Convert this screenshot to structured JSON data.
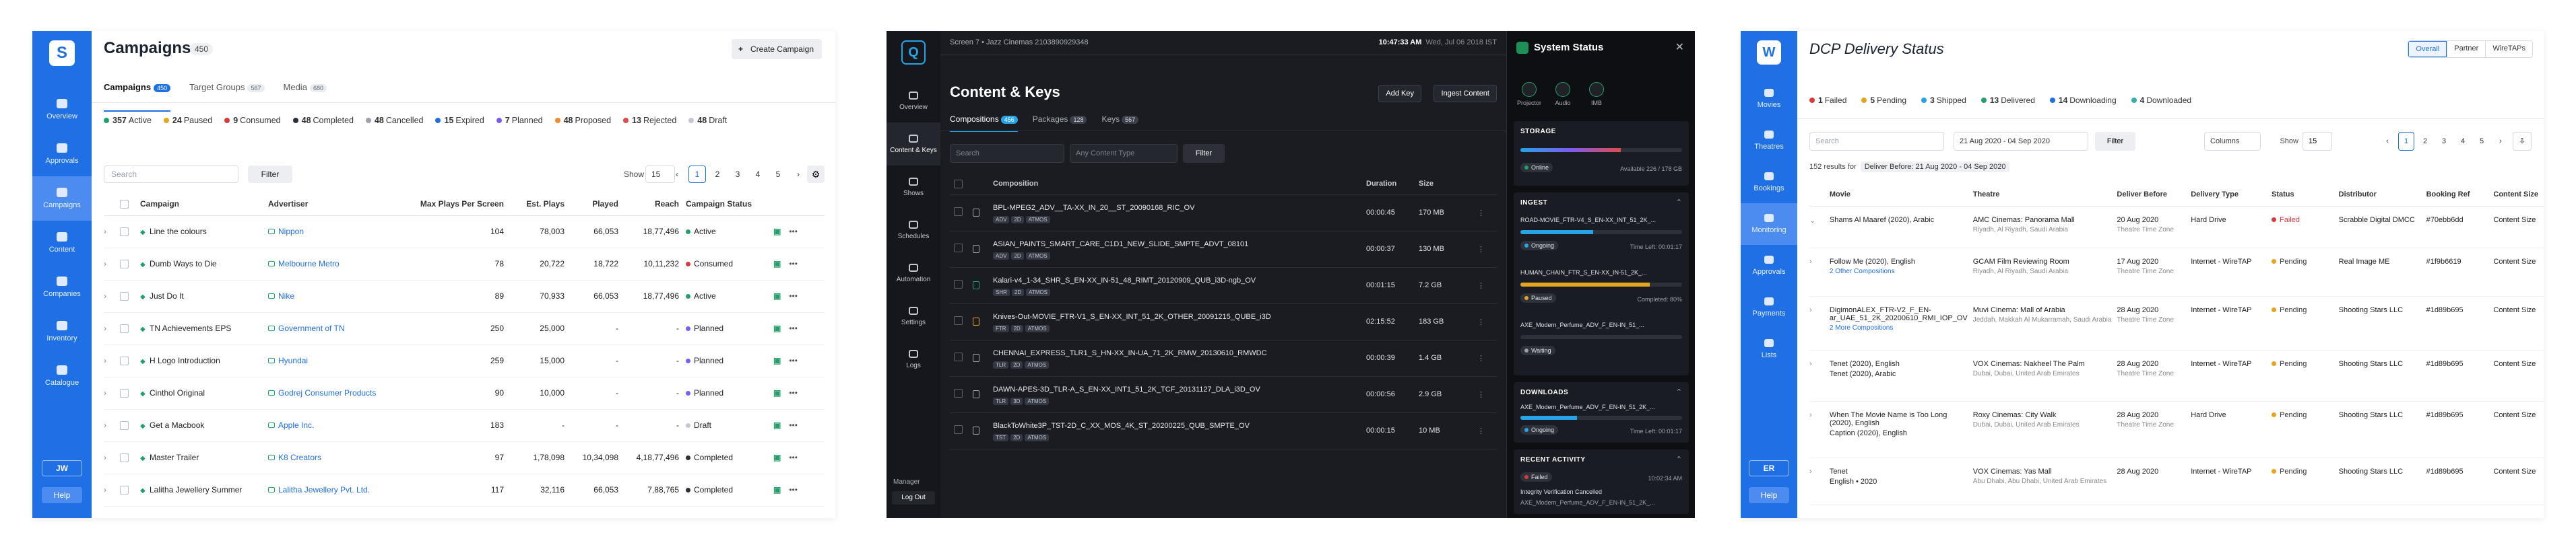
{
  "campaigns": {
    "sidebar": {
      "logo": "S",
      "items": [
        {
          "label": "Overview",
          "active": false
        },
        {
          "label": "Approvals",
          "active": false
        },
        {
          "label": "Campaigns",
          "active": true
        },
        {
          "label": "Content",
          "active": false
        },
        {
          "label": "Companies",
          "active": false
        },
        {
          "label": "Inventory",
          "active": false
        },
        {
          "label": "Catalogue",
          "active": false
        }
      ],
      "user": "JW",
      "help": "Help"
    },
    "title": "Campaigns",
    "count": "450",
    "create_button": "Create Campaign",
    "tabs": [
      {
        "label": "Campaigns",
        "count": "450"
      },
      {
        "label": "Target Groups",
        "count": "567"
      },
      {
        "label": "Media",
        "count": "680"
      }
    ],
    "stats": [
      {
        "value": "357",
        "label": "Active",
        "color": "#22a06b"
      },
      {
        "value": "24",
        "label": "Paused",
        "color": "#e5a521"
      },
      {
        "value": "9",
        "label": "Consumed",
        "color": "#d63b3b"
      },
      {
        "value": "48",
        "label": "Completed",
        "color": "#2b2f37"
      },
      {
        "value": "48",
        "label": "Cancelled",
        "color": "#9aa1ab"
      },
      {
        "value": "15",
        "label": "Expired",
        "color": "#1f6fe5"
      },
      {
        "value": "7",
        "label": "Planned",
        "color": "#7b5cf0"
      },
      {
        "value": "48",
        "label": "Proposed",
        "color": "#f08c2e"
      },
      {
        "value": "13",
        "label": "Rejected",
        "color": "#e14b4b"
      },
      {
        "value": "48",
        "label": "Draft",
        "color": "#c3c8d0"
      }
    ],
    "search_placeholder": "Search",
    "filter": "Filter",
    "show_label": "Show",
    "show_value": "15",
    "pages": [
      "1",
      "2",
      "3",
      "4",
      "5"
    ],
    "columns": [
      "Campaign",
      "Advertiser",
      "Max Plays Per Screen",
      "Est. Plays",
      "Played",
      "Reach",
      "Campaign Status"
    ],
    "rows": [
      {
        "campaign": "Line the colours",
        "advertiser": "Nippon",
        "max": "104",
        "est": "78,003",
        "played": "66,053",
        "reach": "18,77,496",
        "status": "Active",
        "color": "#22a06b"
      },
      {
        "campaign": "Dumb Ways to Die",
        "advertiser": "Melbourne Metro",
        "max": "78",
        "est": "20,722",
        "played": "18,722",
        "reach": "10,11,232",
        "status": "Consumed",
        "color": "#d63b3b"
      },
      {
        "campaign": "Just Do It",
        "advertiser": "Nike",
        "max": "89",
        "est": "70,933",
        "played": "66,053",
        "reach": "18,77,496",
        "status": "Active",
        "color": "#22a06b"
      },
      {
        "campaign": "TN Achievements EPS",
        "advertiser": "Government of TN",
        "max": "250",
        "est": "25,000",
        "played": "-",
        "reach": "-",
        "status": "Planned",
        "color": "#7b5cf0"
      },
      {
        "campaign": "H Logo Introduction",
        "advertiser": "Hyundai",
        "max": "259",
        "est": "15,000",
        "played": "-",
        "reach": "-",
        "status": "Planned",
        "color": "#7b5cf0"
      },
      {
        "campaign": "Cinthol Original",
        "advertiser": "Godrej Consumer Products",
        "max": "90",
        "est": "10,000",
        "played": "-",
        "reach": "-",
        "status": "Planned",
        "color": "#7b5cf0"
      },
      {
        "campaign": "Get a Macbook",
        "advertiser": "Apple Inc.",
        "max": "183",
        "est": "-",
        "played": "-",
        "reach": "-",
        "status": "Draft",
        "color": "#c3c8d0"
      },
      {
        "campaign": "Master Trailer",
        "advertiser": "K8 Creators",
        "max": "97",
        "est": "1,78,098",
        "played": "10,34,098",
        "reach": "4,18,77,496",
        "status": "Completed",
        "color": "#2b2f37"
      },
      {
        "campaign": "Lalitha Jewellery Summer",
        "advertiser": "Lalitha Jewellery Pvt. Ltd.",
        "max": "117",
        "est": "32,116",
        "played": "66,053",
        "reach": "7,88,765",
        "status": "Completed",
        "color": "#2b2f37"
      }
    ]
  },
  "content": {
    "sidebar": {
      "items": [
        {
          "label": "Overview",
          "active": false
        },
        {
          "label": "Content & Keys",
          "active": true
        },
        {
          "label": "Shows",
          "active": false
        },
        {
          "label": "Schedules",
          "active": false
        },
        {
          "label": "Automation",
          "active": false
        },
        {
          "label": "Settings",
          "active": false
        },
        {
          "label": "Logs",
          "active": false
        }
      ],
      "role": "Manager",
      "logout": "Log Out"
    },
    "header": {
      "screen": "Screen 7 • Jazz Cinemas  2103890929348",
      "time": "10:47:33 AM",
      "date": "Wed, Jul 06 2018 IST"
    },
    "title": "Content & Keys",
    "add_key": "Add Key",
    "ingest": "Ingest Content",
    "tabs": [
      {
        "label": "Compositions",
        "count": "456"
      },
      {
        "label": "Packages",
        "count": "128"
      },
      {
        "label": "Keys",
        "count": "567"
      }
    ],
    "search_placeholder": "Search",
    "type_placeholder": "Any Content Type",
    "filter": "Filter",
    "columns": [
      "Composition",
      "Duration",
      "Size"
    ],
    "rows": [
      {
        "name": "BPL-MPEG2_ADV__TA-XX_IN_20__ST_20090168_RIC_OV",
        "tags": [
          "ADV",
          "2D",
          "ATMOS"
        ],
        "duration": "00:00:45",
        "size": "170 MB",
        "state": "none"
      },
      {
        "name": "ASIAN_PAINTS_SMART_CARE_C1D1_NEW_SLIDE_SMPTE_ADVT_08101",
        "tags": [
          "ADV",
          "2D",
          "ATMOS"
        ],
        "duration": "00:00:37",
        "size": "130 MB",
        "state": "none"
      },
      {
        "name": "Kalari-v4_1-34_SHR_S_EN-XX_IN-51_48_RIMT_20120909_QUB_i3D-ngb_OV",
        "tags": [
          "SHR",
          "2D",
          "ATMOS"
        ],
        "duration": "00:01:15",
        "size": "7.2 GB",
        "state": "ok"
      },
      {
        "name": "Knives-Out-MOVIE_FTR-V1_S_EN-XX_INT_51_2K_OTHER_20091215_QUBE_i3D",
        "tags": [
          "FTR",
          "2D",
          "ATMOS"
        ],
        "duration": "02:15:52",
        "size": "183 GB",
        "state": "warn"
      },
      {
        "name": "CHENNAI_EXPRESS_TLR1_S_HN-XX_IN-UA_71_2K_RMW_20130610_RMWDC",
        "tags": [
          "TLR",
          "2D",
          "ATMOS"
        ],
        "duration": "00:00:39",
        "size": "1.4 GB",
        "state": "none"
      },
      {
        "name": "DAWN-APES-3D_TLR-A_S_EN-XX_INT1_51_2K_TCF_20131127_DLA_i3D_OV",
        "tags": [
          "TLR",
          "3D",
          "ATMOS"
        ],
        "duration": "00:00:56",
        "size": "2.9 GB",
        "state": "none"
      },
      {
        "name": "BlackToWhite3P_TST-2D_C_XX_MOS_4K_ST_20200225_QUB_SMPTE_OV",
        "tags": [
          "TST",
          "2D",
          "ATMOS"
        ],
        "duration": "00:00:15",
        "size": "10 MB",
        "state": "none"
      }
    ],
    "system": {
      "title": "System Status",
      "devices": [
        "Projector",
        "Audio",
        "IMB"
      ],
      "storage": {
        "title": "STORAGE",
        "status": "Online",
        "available": "Available 226 / 178 GB",
        "used_fraction": 0.62
      },
      "ingest": {
        "title": "INGEST",
        "items": [
          {
            "name": "ROAD-MOVIE_FTR-V4_S_EN-XX_INT_51_2K_...",
            "status": "Ongoing",
            "note": "Time Left: 00:01:17",
            "progress": 0.45,
            "color": "#27a3e6"
          },
          {
            "name": "HUMAN_CHAIN_FTR_S_EN-XX_IN-51_2K_...",
            "status": "Paused",
            "note": "Completed: 80%",
            "progress": 0.8,
            "color": "#e5a521"
          },
          {
            "name": "AXE_Modern_Perfume_ADV_F_EN-IN_51_...",
            "status": "Waiting",
            "note": "",
            "progress": 0,
            "color": "#9aa1ab"
          }
        ]
      },
      "downloads": {
        "title": "DOWNLOADS",
        "items": [
          {
            "name": "AXE_Modern_Perfume_ADV_F_EN-IN_51_2K_...",
            "status": "Ongoing",
            "note": "Time Left: 00:01:17",
            "progress": 0.35
          }
        ]
      },
      "recent": {
        "title": "RECENT ACTIVITY",
        "status": "Failed",
        "time": "10:02:34 AM",
        "text": "Integrity Verification Cancelled",
        "detail": "AXE_Modern_Perfume_ADV_F_EN-IN_51_2K_..."
      }
    }
  },
  "dcp": {
    "sidebar": {
      "logo": "W",
      "items": [
        {
          "label": "Movies",
          "active": false
        },
        {
          "label": "Theatres",
          "active": false
        },
        {
          "label": "Bookings",
          "active": false
        },
        {
          "label": "Monitoring",
          "active": true
        },
        {
          "label": "Approvals",
          "active": false
        },
        {
          "label": "Payments",
          "active": false
        },
        {
          "label": "Lists",
          "active": false
        }
      ],
      "user": "ER",
      "help": "Help"
    },
    "title": "DCP Delivery Status",
    "segments": [
      "Overall",
      "Partner",
      "WireTAPs"
    ],
    "stats": [
      {
        "value": "1",
        "label": "Failed",
        "color": "#d63b3b"
      },
      {
        "value": "5",
        "label": "Pending",
        "color": "#e5a521"
      },
      {
        "value": "3",
        "label": "Shipped",
        "color": "#27a3e6"
      },
      {
        "value": "13",
        "label": "Delivered",
        "color": "#22a06b"
      },
      {
        "value": "14",
        "label": "Downloading",
        "color": "#1f6fe5"
      },
      {
        "value": "4",
        "label": "Downloaded",
        "color": "#2db5a8"
      }
    ],
    "search_placeholder": "Search",
    "date_range": "21 Aug 2020 - 04 Sep 2020",
    "filter": "Filter",
    "columns_btn": "Columns",
    "show_label": "Show",
    "show_value": "15",
    "pages": [
      "1",
      "2",
      "3",
      "4",
      "5"
    ],
    "results": "152 results for",
    "chip": "Deliver Before: 21 Aug 2020 - 04 Sep 2020",
    "columns": [
      "Movie",
      "Theatre",
      "Deliver Before",
      "Delivery Type",
      "Status",
      "Distributor",
      "Booking Ref",
      "Content Size"
    ],
    "rows": [
      {
        "movie": "Shams Al Maaref (2020), Arabic",
        "movie_sub": "",
        "movie_link": "",
        "theatre": "AMC Cinemas: Panorama Mall",
        "theatre_sub": "Riyadh, Al Riyadh, Saudi Arabia",
        "deliver": "20 Aug 2020",
        "deliver_sub": "Theatre Time Zone",
        "type": "Hard Drive",
        "status": "Failed",
        "status_color": "#d63b3b",
        "distributor": "Scrabble Digital DMCC",
        "ref": "#70ebb6dd",
        "size": "Content Size"
      },
      {
        "movie": "Follow Me (2020), English",
        "movie_sub": "",
        "movie_link": "2 Other Compositions",
        "theatre": "GCAM Film Reviewing Room",
        "theatre_sub": "Riyadh, Al Riyadh, Saudi Arabia",
        "deliver": "17 Aug 2020",
        "deliver_sub": "Theatre Time Zone",
        "type": "Internet - WireTAP",
        "status": "Pending",
        "status_color": "#e5a521",
        "distributor": "Real Image ME",
        "ref": "#1f9b6619",
        "size": "Content Size"
      },
      {
        "movie": "DigimonALEX_FTR-V2_F_EN-ar_UAE_51_2K_20200610_RMI_IOP_OV",
        "movie_sub": "",
        "movie_link": "2 More Compositions",
        "theatre": "Muvi Cinema: Mall of Arabia",
        "theatre_sub": "Jeddah, Makkah Al Mukarramah, Saudi Arabia",
        "deliver": "28 Aug 2020",
        "deliver_sub": "Theatre Time Zone",
        "type": "Internet - WireTAP",
        "status": "Pending",
        "status_color": "#e5a521",
        "distributor": "Shooting Stars LLC",
        "ref": "#1d89b695",
        "size": "Content Size"
      },
      {
        "movie": "Tenet (2020), English",
        "movie_sub": "Tenet (2020), Arabic",
        "movie_link": "",
        "theatre": "VOX Cinemas: Nakheel The Palm",
        "theatre_sub": "Dubai, Dubai, United Arab Emirates",
        "deliver": "28 Aug 2020",
        "deliver_sub": "Theatre Time Zone",
        "type": "Internet - WireTAP",
        "status": "Pending",
        "status_color": "#e5a521",
        "distributor": "Shooting Stars LLC",
        "ref": "#1d89b695",
        "size": "Content Size"
      },
      {
        "movie": "When The Movie Name is Too Long (2020), English",
        "movie_sub": "Caption (2020), English",
        "movie_link": "",
        "theatre": "Roxy Cinemas: City Walk",
        "theatre_sub": "Dubai, Dubai, United Arab Emirates",
        "deliver": "28 Aug 2020",
        "deliver_sub": "Theatre Time Zone",
        "type": "Hard Drive",
        "status": "Pending",
        "status_color": "#e5a521",
        "distributor": "Shooting Stars LLC",
        "ref": "#1d89b695",
        "size": "Content Size"
      },
      {
        "movie": "Tenet",
        "movie_sub": "English • 2020",
        "movie_link": "",
        "theatre": "VOX Cinemas: Yas Mall",
        "theatre_sub": "Abu Dhabi, Abu Dhabi, United Arab Emirates",
        "deliver": "28 Aug 2020",
        "deliver_sub": "",
        "type": "Internet - WireTAP",
        "status": "Pending",
        "status_color": "#e5a521",
        "distributor": "Shooting Stars LLC",
        "ref": "#1d89b695",
        "size": "Content Size"
      }
    ]
  }
}
